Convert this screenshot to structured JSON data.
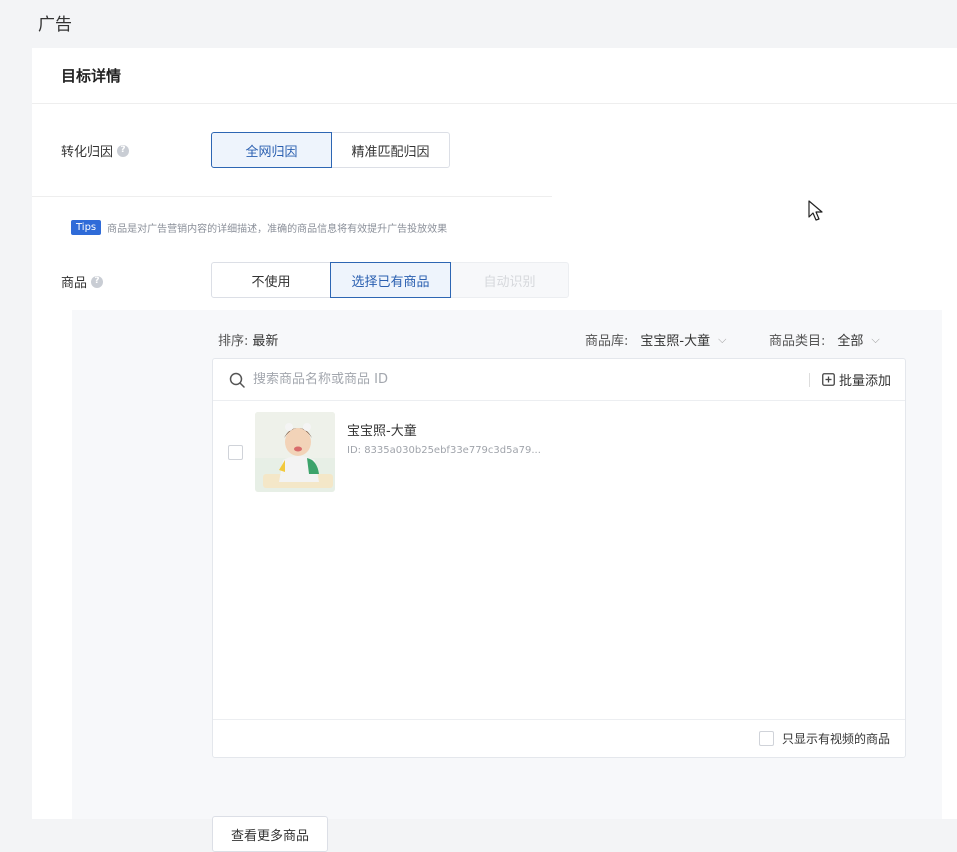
{
  "page": {
    "title": "广告"
  },
  "section": {
    "title": "目标详情"
  },
  "attribution": {
    "label": "转化归因",
    "options": [
      "全网归因",
      "精准匹配归因"
    ],
    "selected": "全网归因"
  },
  "tips": {
    "badge": "Tips",
    "text": "商品是对广告营销内容的详细描述，准确的商品信息将有效提升广告投放效果"
  },
  "product": {
    "label": "商品",
    "options": [
      "不使用",
      "选择已有商品",
      "自动识别"
    ],
    "selected": "选择已有商品",
    "disabled_option": "自动识别"
  },
  "filters": {
    "sort_label": "排序:",
    "sort_value": "最新",
    "library_label": "商品库:",
    "library_value": "宝宝照-大童",
    "category_label": "商品类目:",
    "category_value": "全部"
  },
  "search": {
    "placeholder": "搜索商品名称或商品 ID",
    "bulk_add": "批量添加"
  },
  "items": [
    {
      "name": "宝宝照-大童",
      "id": "ID: 8335a030b25ebf33e779c3d5a79..."
    }
  ],
  "footer": {
    "only_video": "只显示有视频的商品"
  },
  "more_button": "查看更多商品",
  "colors": {
    "accent": "#2d66b3",
    "tips_badge": "#2f6bd8"
  }
}
